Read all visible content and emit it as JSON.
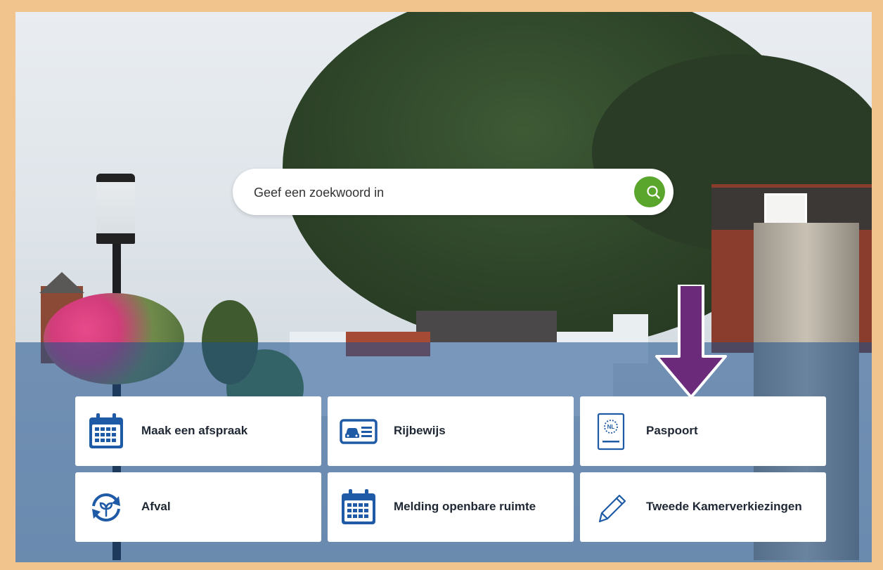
{
  "search": {
    "placeholder": "Geef een zoekwoord in",
    "icon": "search-icon",
    "button_color": "#5aa52c"
  },
  "tiles": [
    {
      "label": "Maak een afspraak",
      "icon": "calendar-icon"
    },
    {
      "label": "Rijbewijs",
      "icon": "drivers-license-icon"
    },
    {
      "label": "Paspoort",
      "icon": "passport-icon"
    },
    {
      "label": "Afval",
      "icon": "recycle-icon"
    },
    {
      "label": "Melding openbare ruimte",
      "icon": "calendar-icon"
    },
    {
      "label": "Tweede Kamerverkiezingen",
      "icon": "pencil-icon"
    }
  ],
  "annotation": {
    "icon": "arrow-down-icon",
    "color": "#6b2a7a"
  },
  "colors": {
    "frame": "#f2c48d",
    "tile_icon": "#1f5aa6",
    "text": "#1e2733"
  }
}
